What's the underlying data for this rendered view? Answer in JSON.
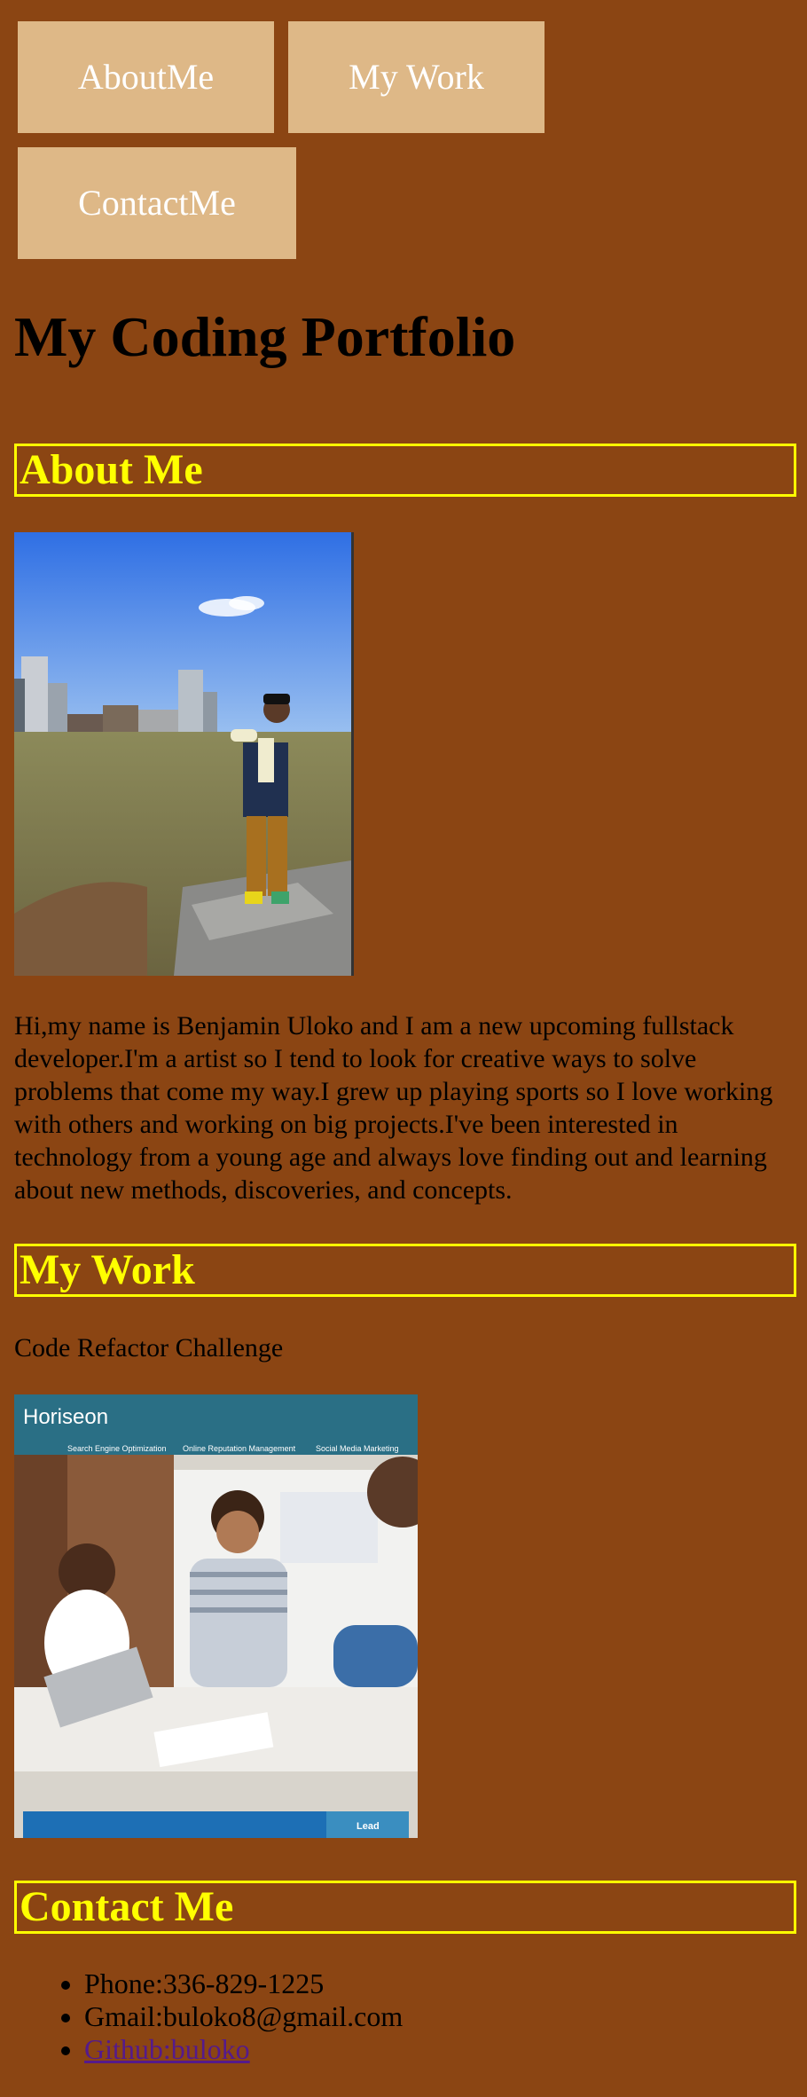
{
  "nav": {
    "about": "AboutMe",
    "work": "My Work",
    "contact": "ContactMe"
  },
  "page_title": "My Coding Portfolio",
  "about": {
    "heading": "About Me",
    "bio": "Hi,my name is Benjamin Uloko and I am a new upcoming fullstack developer.I'm a artist so I tend to look for creative ways to solve problems that come my way.I grew up playing sports so I love working with others and working on big projects.I've been interested in technology from a young age and always love finding out and learning about new methods, discoveries, and concepts."
  },
  "work": {
    "heading": "My Work",
    "project_title": "Code Refactor Challenge",
    "preview": {
      "brand": "Horiseon",
      "menu": [
        "Search Engine Optimization",
        "Online Reputation Management",
        "Social Media Marketing"
      ],
      "cta": "Lead"
    }
  },
  "contact": {
    "heading": "Contact Me",
    "phone": "Phone:336-829-1225",
    "gmail": "Gmail:buloko8@gmail.com",
    "github": "Github:buloko"
  },
  "colors": {
    "background": "#8B4513",
    "nav_button": "#DEB887",
    "heading_accent": "#FFFF00",
    "visited_link": "#551A8B"
  }
}
